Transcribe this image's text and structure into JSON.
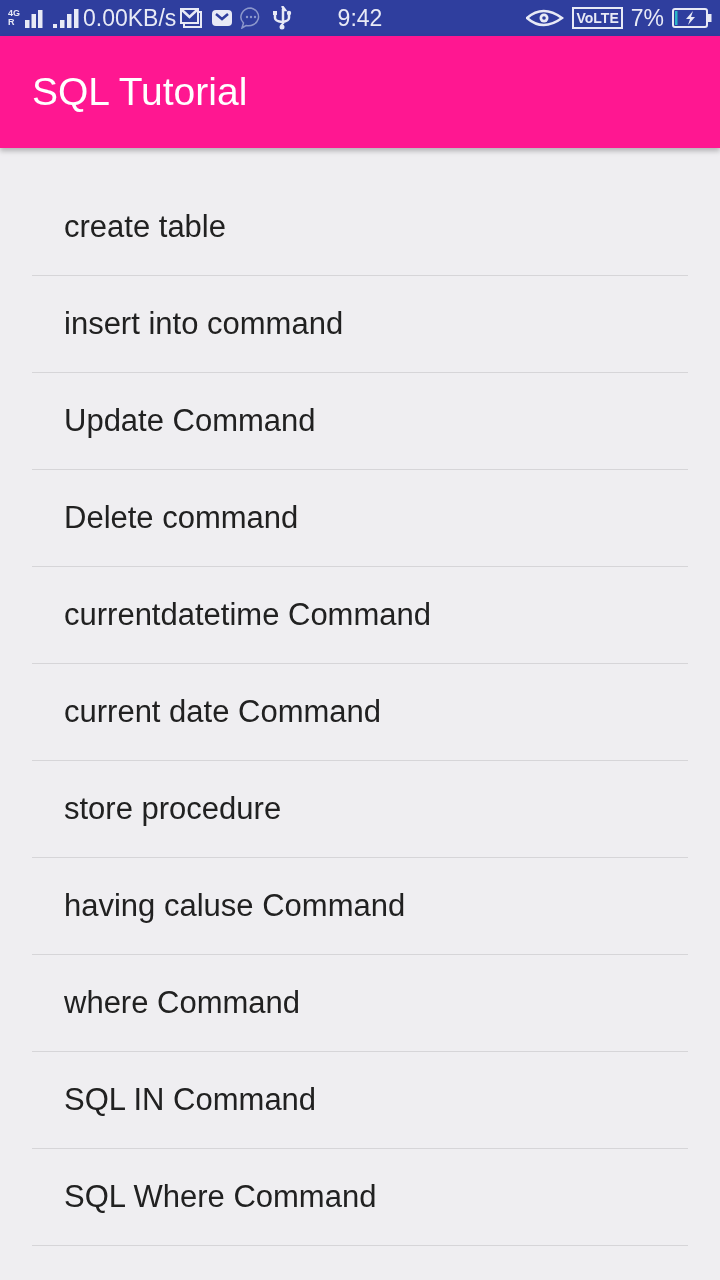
{
  "status_bar": {
    "network_type": "4G",
    "roaming": "R",
    "data_speed": "0.00KB/s",
    "time": "9:42",
    "volte": "VoLTE",
    "battery": "7%"
  },
  "app_bar": {
    "title": "SQL Tutorial"
  },
  "topics": [
    "create table",
    "insert into command",
    "Update Command",
    "Delete command",
    "currentdatetime Command",
    "current date Command",
    "store procedure",
    "having caluse Command",
    "where Command",
    "SQL IN Command",
    "SQL Where Command"
  ]
}
